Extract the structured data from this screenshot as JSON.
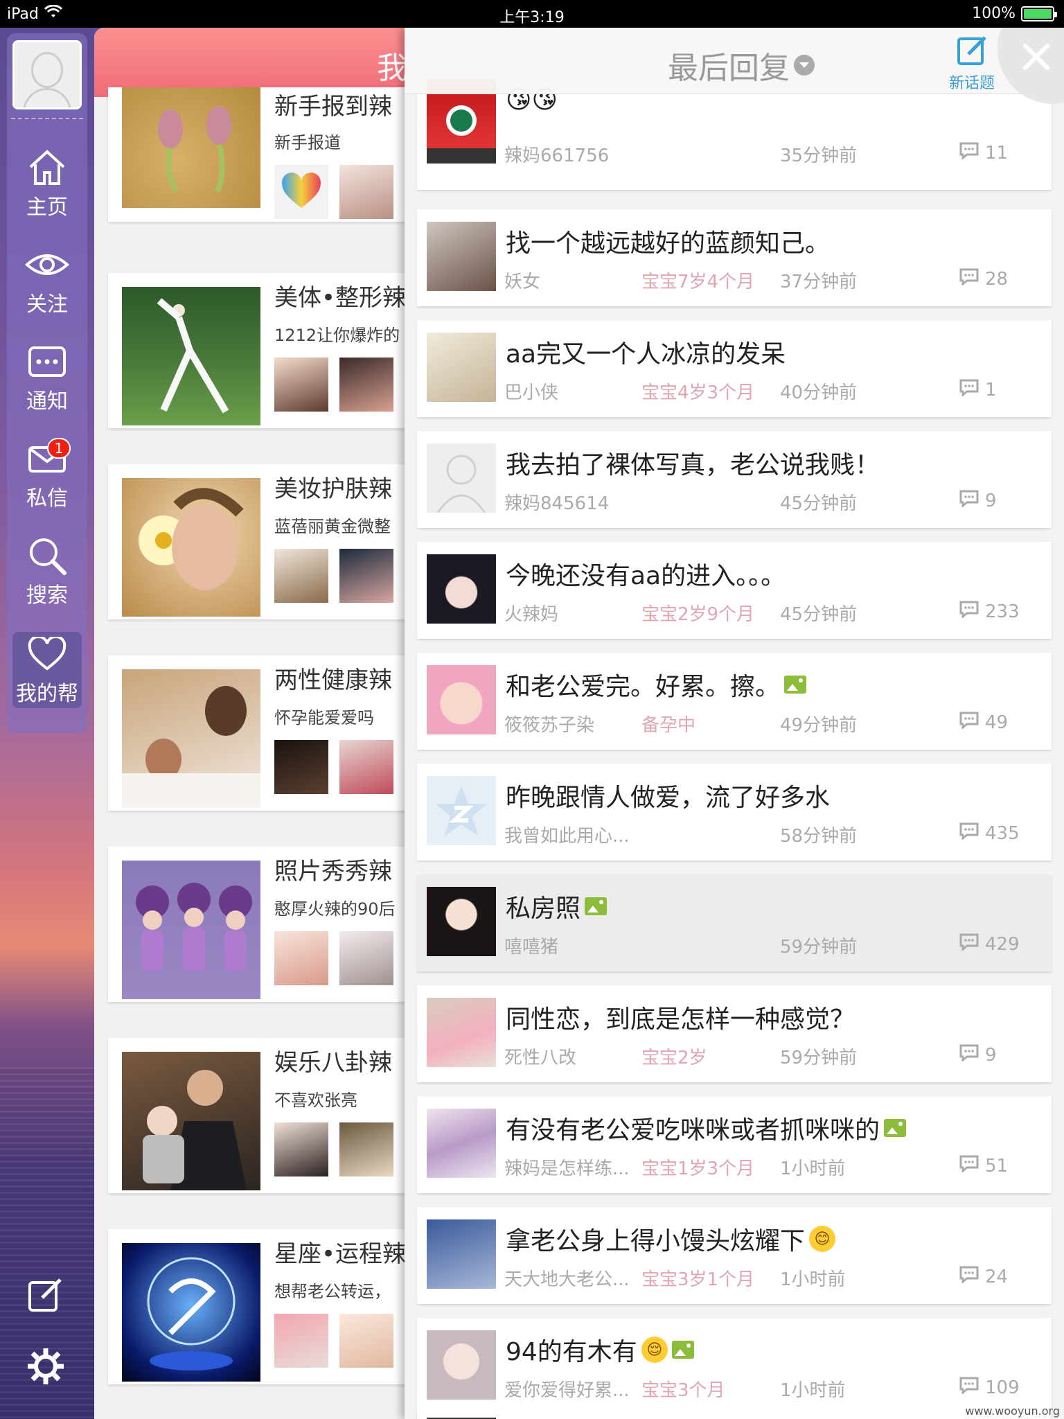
{
  "status_bar": {
    "device": "iPad",
    "time": "上午3:19",
    "battery": "100%"
  },
  "sidebar": {
    "items": [
      {
        "label": "主页",
        "icon": "home-icon"
      },
      {
        "label": "关注",
        "icon": "eye-icon"
      },
      {
        "label": "通知",
        "icon": "notification-icon"
      },
      {
        "label": "私信",
        "icon": "mail-icon",
        "badge": "1"
      },
      {
        "label": "搜索",
        "icon": "search-icon"
      },
      {
        "label": "我的帮",
        "icon": "heart-icon",
        "active": true
      }
    ],
    "bottom": [
      "compose-icon",
      "gear-icon"
    ]
  },
  "middle": {
    "header_title": "我",
    "groups": [
      {
        "name": "新手报到辣",
        "sub": "新手报道"
      },
      {
        "name": "美体•整形辣",
        "sub": "1212让你爆炸的"
      },
      {
        "name": "美妆护肤辣",
        "sub": "蓝蓓丽黄金微整"
      },
      {
        "name": "两性健康辣",
        "sub": "怀孕能爱爱吗"
      },
      {
        "name": "照片秀秀辣",
        "sub": "憨厚火辣的90后"
      },
      {
        "name": "娱乐八卦辣",
        "sub": "不喜欢张亮"
      },
      {
        "name": "星座•运程辣",
        "sub": "想帮老公转运，"
      }
    ]
  },
  "topics_panel": {
    "sort_label": "最后回复",
    "new_topic_label": "新话题",
    "topics": [
      {
        "title": "😘😘",
        "author": "辣妈661756",
        "baby": "",
        "time": "35分钟前",
        "comments": "11"
      },
      {
        "title": "找一个越远越好的蓝颜知己。",
        "author": "妖女",
        "baby": "宝宝7岁4个月",
        "time": "37分钟前",
        "comments": "28"
      },
      {
        "title": "aa完又一个人冰凉的发呆",
        "author": "巴小侠",
        "baby": "宝宝4岁3个月",
        "time": "40分钟前",
        "comments": "1"
      },
      {
        "title": "我去拍了裸体写真，老公说我贱！",
        "author": "辣妈845614",
        "baby": "",
        "time": "45分钟前",
        "comments": "9"
      },
      {
        "title": "今晚还没有aa的进入。。。",
        "author": "火辣妈",
        "baby": "宝宝2岁9个月",
        "time": "45分钟前",
        "comments": "233"
      },
      {
        "title": "和老公爱完。好累。擦。",
        "author": "筱筱苏子染",
        "baby": "备孕中",
        "time": "49分钟前",
        "comments": "49",
        "image": true
      },
      {
        "title": "昨晚跟情人做爱，流了好多水",
        "author": "我曾如此用心...",
        "baby": "",
        "time": "58分钟前",
        "comments": "435"
      },
      {
        "title": "私房照",
        "author": "嘻嘻猪",
        "baby": "",
        "time": "59分钟前",
        "comments": "429",
        "image": true,
        "highlight": true
      },
      {
        "title": "同性恋，到底是怎样一种感觉？",
        "author": "死性八改",
        "baby": "宝宝2岁",
        "time": "59分钟前",
        "comments": "9"
      },
      {
        "title": "有没有老公爱吃咪咪或者抓咪咪的",
        "author": "辣妈是怎样练...",
        "baby": "宝宝1岁3个月",
        "time": "1小时前",
        "comments": "51",
        "image": true
      },
      {
        "title": "拿老公身上得小馒头炫耀下",
        "author": "天大地大老公...",
        "baby": "宝宝3岁1个月",
        "time": "1小时前",
        "comments": "24",
        "emoji": "😊"
      },
      {
        "title": "94的有木有",
        "author": "爱你爱得好累...",
        "baby": "宝宝3个月",
        "time": "1小时前",
        "comments": "109",
        "emoji": "😌",
        "image": true
      }
    ]
  },
  "watermark": "www.wooyun.org",
  "colors": {
    "accent_pink": "#f06c78",
    "baby_text": "#e0a5b0",
    "new_topic_blue": "#3aa0d8",
    "image_badge": "#8cbd3a"
  }
}
